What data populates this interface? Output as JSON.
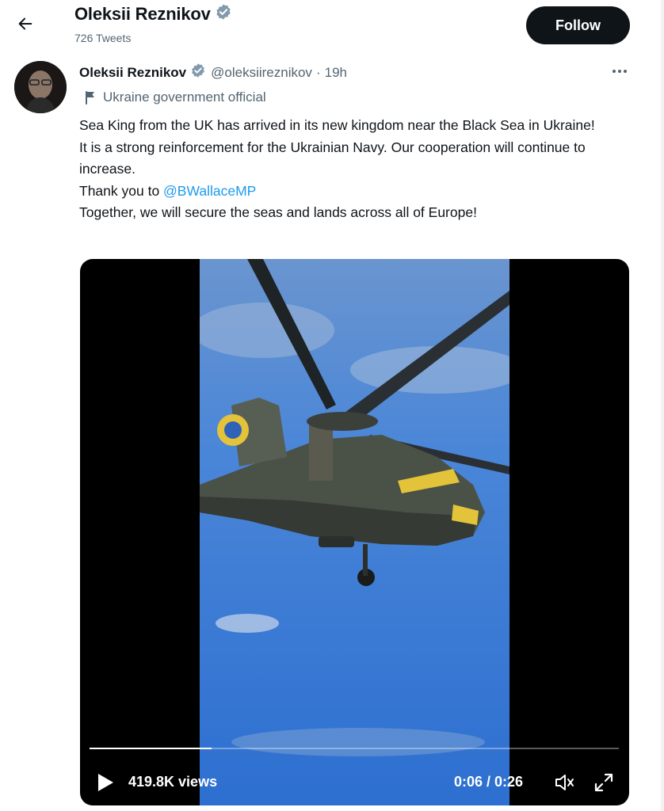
{
  "header": {
    "back_icon": "arrow-left-icon",
    "name": "Oleksii Reznikov",
    "tweet_count": "726 Tweets",
    "follow_label": "Follow"
  },
  "tweet": {
    "author_name": "Oleksii Reznikov",
    "handle": "@oleksiireznikov",
    "separator": "·",
    "time": "19h",
    "label": "Ukraine government official",
    "text": {
      "line1": "Sea King from the UK has arrived in its new kingdom near the Black Sea in Ukraine!",
      "line2": "It is a strong reinforcement for the Ukrainian Navy. Our cooperation will continue to increase.",
      "line3_prefix": "Thank you to ",
      "mention": "@BWallaceMP",
      "line4": "Together, we will secure the seas and lands across all of Europe!"
    }
  },
  "video": {
    "views": "419.8K views",
    "time": "0:06 / 0:26",
    "progress": 0.23
  },
  "colors": {
    "accent": "#1d9bf0",
    "text": "#0f1419",
    "muted": "#536471",
    "follow_bg": "#0f1419",
    "sky": "#3f7ed6"
  }
}
